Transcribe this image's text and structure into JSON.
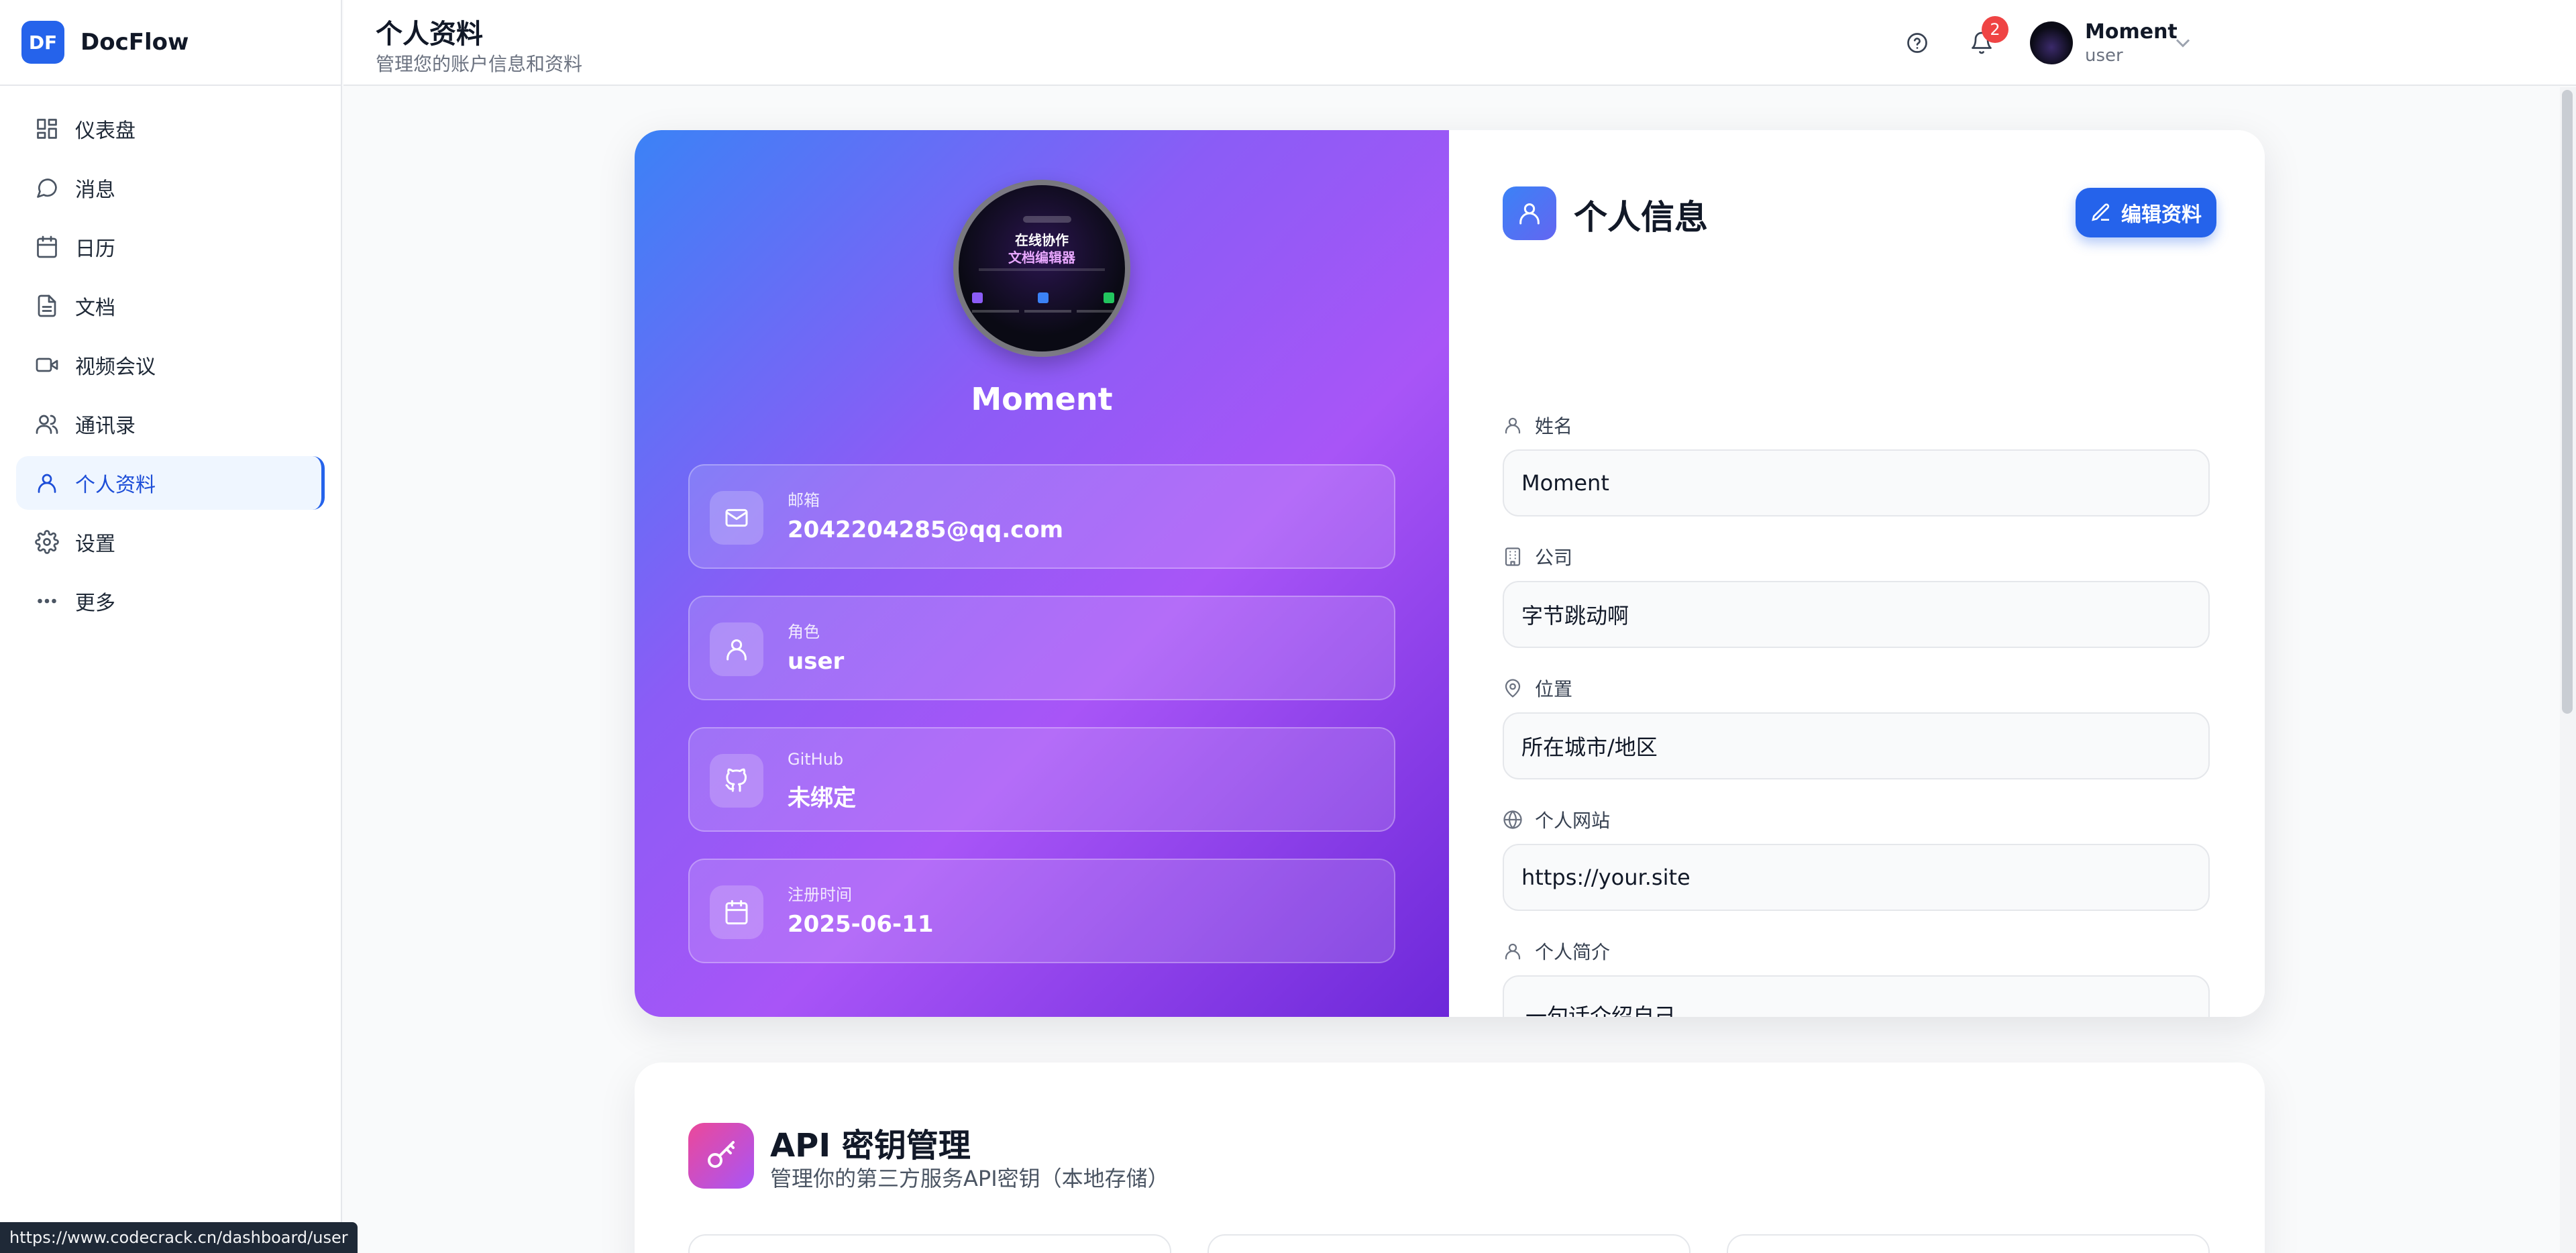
{
  "app": {
    "logo_text": "DF",
    "name": "DocFlow"
  },
  "sidebar": {
    "items": [
      {
        "label": "仪表盘",
        "icon": "dashboard-icon"
      },
      {
        "label": "消息",
        "icon": "message-icon"
      },
      {
        "label": "日历",
        "icon": "calendar-icon"
      },
      {
        "label": "文档",
        "icon": "document-icon"
      },
      {
        "label": "视频会议",
        "icon": "video-icon"
      },
      {
        "label": "通讯录",
        "icon": "contacts-icon"
      },
      {
        "label": "个人资料",
        "icon": "user-icon",
        "active": true
      },
      {
        "label": "设置",
        "icon": "gear-icon"
      },
      {
        "label": "更多",
        "icon": "more-icon"
      }
    ]
  },
  "header": {
    "title": "个人资料",
    "subtitle": "管理您的账户信息和资料",
    "notification_count": "2",
    "user": {
      "name": "Moment",
      "role": "user"
    }
  },
  "profile": {
    "name": "Moment",
    "avatar": {
      "line1": "在线协作",
      "line2": "文档编辑器"
    },
    "tiles": [
      {
        "label": "邮箱",
        "value": "2042204285@qq.com",
        "icon": "mail-icon"
      },
      {
        "label": "角色",
        "value": "user",
        "icon": "user-icon"
      },
      {
        "label": "GitHub",
        "value": "未绑定",
        "icon": "github-icon"
      },
      {
        "label": "注册时间",
        "value": "2025-06-11",
        "icon": "calendar-icon"
      }
    ]
  },
  "personal_info": {
    "title": "个人信息",
    "edit_label": "编辑资料",
    "fields": [
      {
        "label": "姓名",
        "value": "Moment",
        "icon": "user-icon"
      },
      {
        "label": "公司",
        "value": "字节跳动啊",
        "icon": "building-icon"
      },
      {
        "label": "位置",
        "value": "所在城市/地区",
        "icon": "map-pin-icon"
      },
      {
        "label": "个人网站",
        "value": "https://your.site",
        "icon": "globe-icon"
      },
      {
        "label": "个人简介",
        "value": "一句话介绍自己...",
        "icon": "user-icon"
      }
    ]
  },
  "api": {
    "title": "API 密钥管理",
    "subtitle": "管理你的第三方服务API密钥（本地存储）"
  },
  "status_bar": {
    "url": "https://www.codecrack.cn/dashboard/user"
  },
  "colors": {
    "accent": "#2563eb",
    "badge": "#ef4444",
    "gradient_start": "#3b82f6",
    "gradient_end": "#a855f7"
  }
}
